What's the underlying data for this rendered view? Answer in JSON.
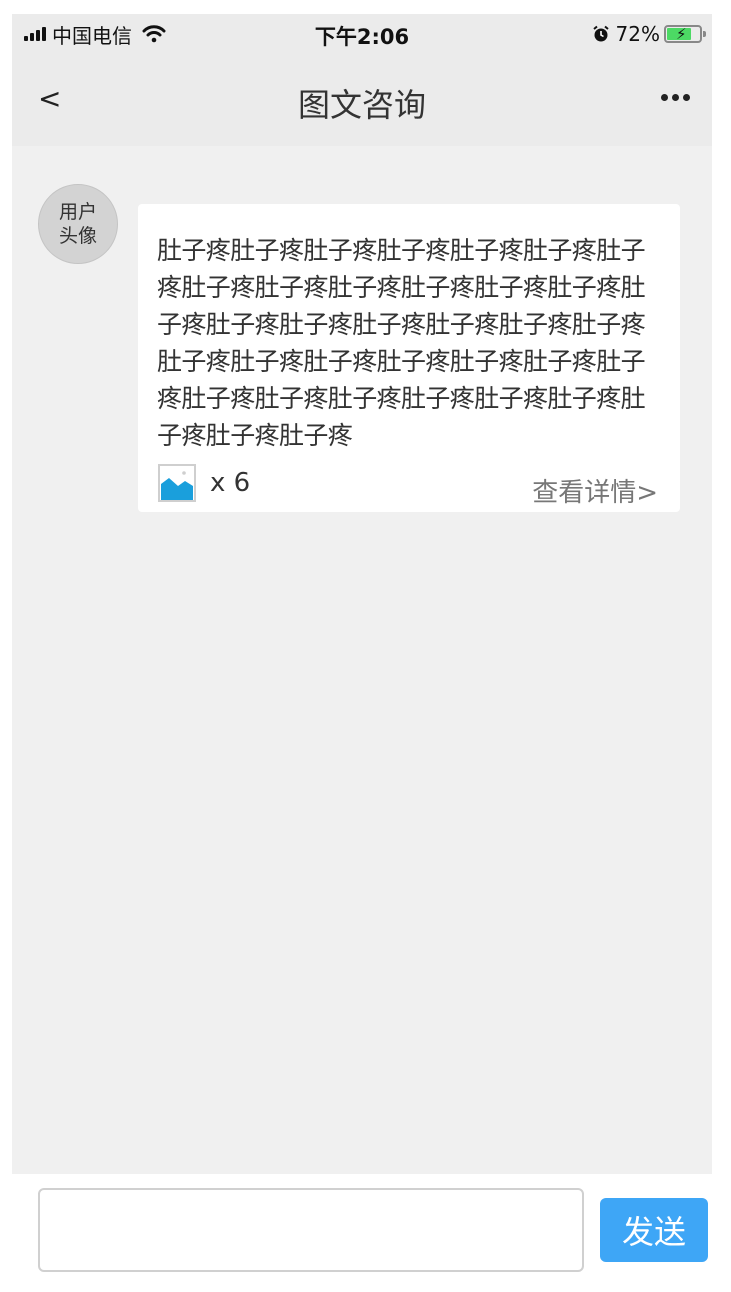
{
  "status_bar": {
    "carrier": "中国电信",
    "time": "下午2:06",
    "battery_percent": "72%",
    "icons": [
      "signal-icon",
      "wifi-icon",
      "alarm-icon",
      "battery-charging-icon"
    ]
  },
  "nav": {
    "back_label": "<",
    "title": "图文咨询",
    "more_icon": "more-dots-icon"
  },
  "message": {
    "avatar_label": "用户头像",
    "text": "肚子疼肚子疼肚子疼肚子疼肚子疼肚子疼肚子疼肚子疼肚子疼肚子疼肚子疼肚子疼肚子疼肚子疼肚子疼肚子疼肚子疼肚子疼肚子疼肚子疼肚子疼肚子疼肚子疼肚子疼肚子疼肚子疼肚子疼肚子疼肚子疼肚子疼肚子疼肚子疼肚子疼肚子疼肚子疼肚子疼",
    "image_icon": "image-icon",
    "image_count": "x 6",
    "detail_link": "查看详情>"
  },
  "composer": {
    "input_value": "",
    "send_label": "发送"
  },
  "colors": {
    "send_button": "#3ea6f6",
    "background": "#f0f0f0",
    "header": "#ebebeb",
    "battery_fill": "#4cd964"
  }
}
